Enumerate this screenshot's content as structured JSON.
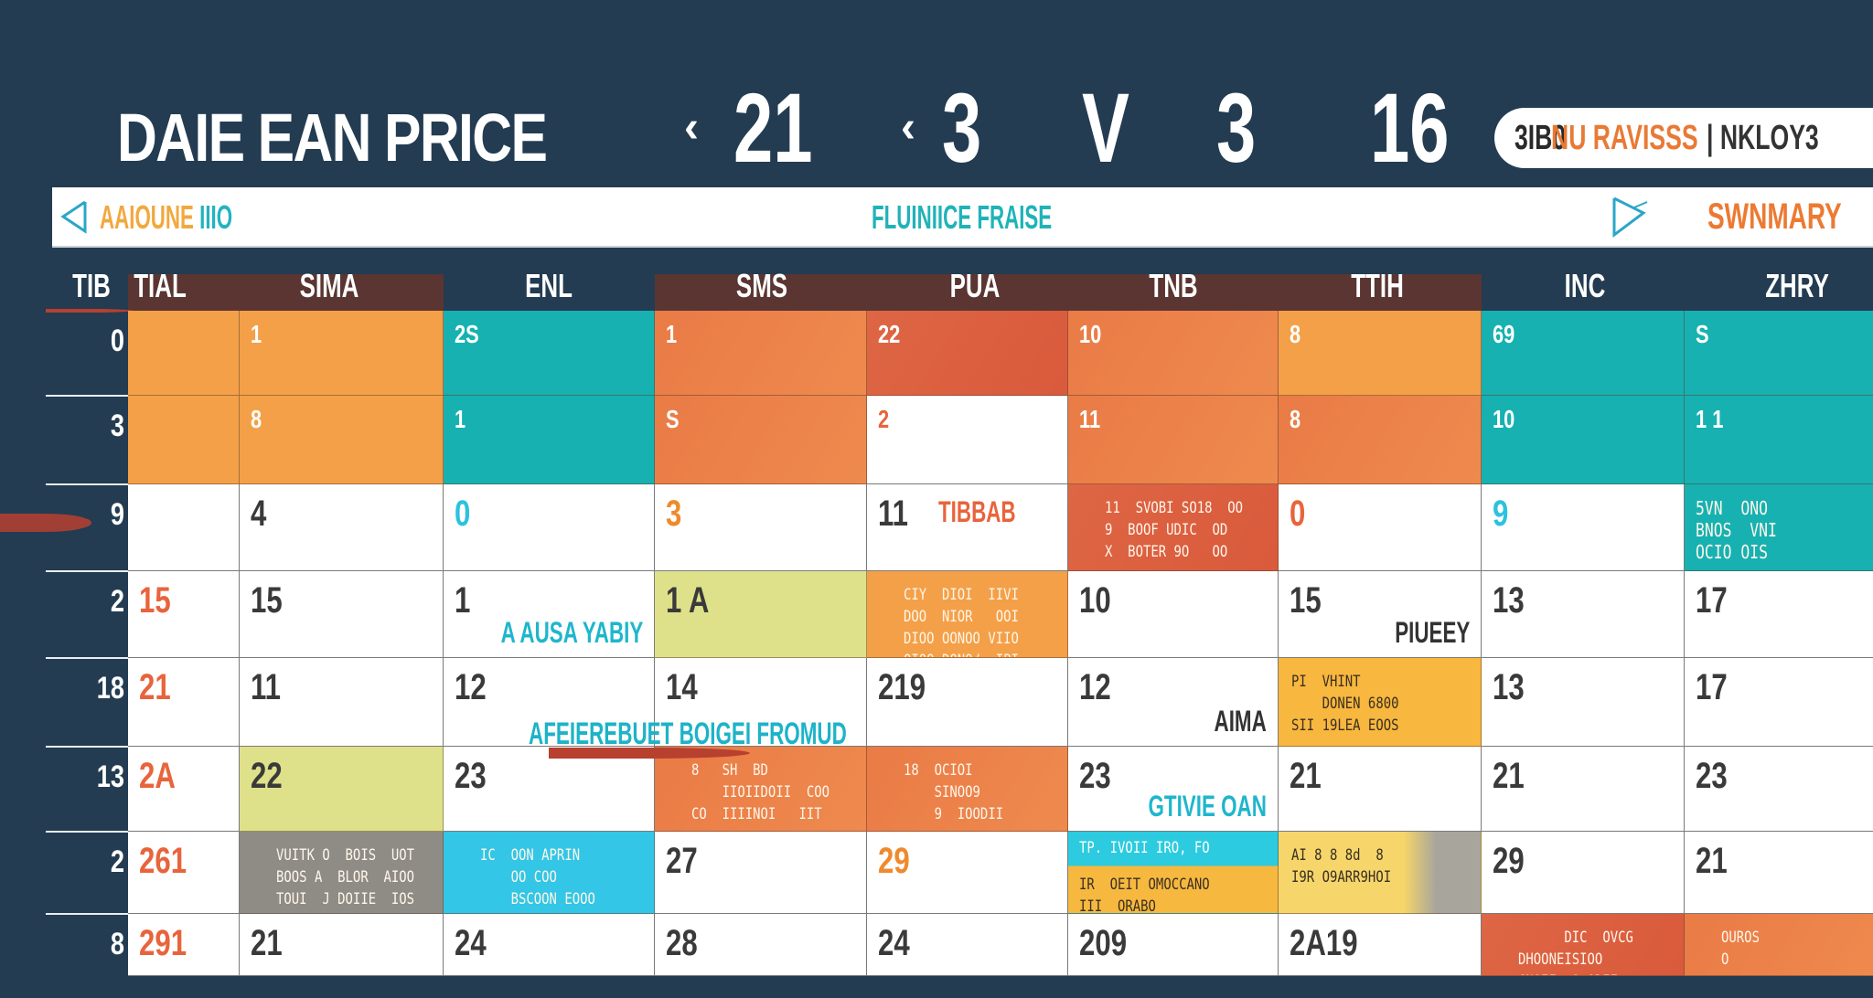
{
  "header": {
    "title": "DAIE EAN PRICE",
    "nav": [
      {
        "chevron": "‹",
        "value": "21"
      },
      {
        "chevron": "‹",
        "value": "3"
      },
      {
        "chevron": "",
        "value": "V"
      },
      {
        "chevron": "",
        "value": "3"
      },
      {
        "chevron": "",
        "value": "16"
      }
    ],
    "pill": {
      "part1": "3IB0",
      "part2": "NU RAVISSS",
      "part3": "| NKLOY3"
    }
  },
  "toolbar": {
    "left_label_a": "AAIOUNE",
    "left_label_b": "IIIO",
    "center_label": "FLUINIICE FRAISE",
    "right_label": "SWNMARY"
  },
  "colors": {
    "background": "#233c52",
    "orange": "#f39a3f",
    "dark_orange": "#e87546",
    "red_orange": "#df6540",
    "teal": "#18b2b0",
    "cyan": "#2dc8e3",
    "lime": "#d9dd80",
    "yellow": "#f7b63a",
    "gray": "#8d8b85",
    "header_band": "#5a3532"
  },
  "grid": {
    "col_headers": [
      "TIB",
      "TIAL",
      "SIMA",
      "ENL",
      "SMS",
      "PUA",
      "TNB",
      "TTIH",
      "INC",
      "ZHRY"
    ],
    "row_labels": [
      "0",
      "3",
      "9",
      "2",
      "18",
      "13",
      "2",
      "8"
    ],
    "rows": [
      [
        {
          "num": "",
          "fill": "orange"
        },
        {
          "num": "1",
          "fill": "orange",
          "num_color": "white"
        },
        {
          "num": "2S",
          "fill": "teal",
          "num_color": "white"
        },
        {
          "num": "1",
          "fill": "dark_orange",
          "num_color": "white"
        },
        {
          "num": "22",
          "fill": "red_orange",
          "num_color": "white"
        },
        {
          "num": "10",
          "fill": "dark_orange",
          "num_color": "white"
        },
        {
          "num": "8",
          "fill": "orange",
          "num_color": "white"
        },
        {
          "num": "69",
          "fill": "teal",
          "num_color": "white"
        },
        {
          "num": "S",
          "fill": "teal",
          "num_color": "white"
        }
      ],
      [
        {
          "num": "",
          "fill": "orange"
        },
        {
          "num": "8",
          "fill": "orange",
          "num_color": "white"
        },
        {
          "num": "1",
          "fill": "teal",
          "num_color": "white"
        },
        {
          "num": "S",
          "fill": "dark_orange",
          "num_color": "white"
        },
        {
          "num": "2",
          "fill": "white",
          "num_color": "red"
        },
        {
          "num": "11",
          "fill": "dark_orange",
          "num_color": "white"
        },
        {
          "num": "8",
          "fill": "dark_orange",
          "num_color": "white"
        },
        {
          "num": "10",
          "fill": "teal",
          "num_color": "white"
        },
        {
          "num": "1 1",
          "fill": "teal",
          "num_color": "white"
        }
      ],
      [
        {
          "num": "",
          "fill": "white"
        },
        {
          "num": "4",
          "fill": "white"
        },
        {
          "num": "0",
          "fill": "white",
          "num_color": "cyan"
        },
        {
          "num": "3",
          "fill": "white",
          "num_color": "orange"
        },
        {
          "num": "11",
          "fill": "white",
          "label": "TIBBAB",
          "label_color": "red"
        },
        {
          "num": "",
          "fill": "red_orange",
          "event": "11  SVOBI SO18  OO\n9  BOOF UDIC  OD\nX  BOTER 9O   OO"
        },
        {
          "num": "0",
          "fill": "white",
          "num_color": "red"
        },
        {
          "num": "9",
          "fill": "white",
          "num_color": "cyan"
        },
        {
          "num": "",
          "fill": "teal",
          "event": "5VN  ONO\nBNOS  VNI\nOCIO OIS"
        }
      ],
      [
        {
          "num": "15",
          "fill": "white",
          "num_color": "red"
        },
        {
          "num": "15",
          "fill": "white"
        },
        {
          "num": "1",
          "fill": "white",
          "label": "A AUSA YABIY",
          "label_color": "cyan"
        },
        {
          "num": "1 A",
          "fill": "lime"
        },
        {
          "num": "",
          "fill": "orange",
          "event": "CIY  DIOI  IIVI\nDOO  NIOR   OOI\nDIOO OONOO VIIO\nOIOO DONO/  IPI"
        },
        {
          "num": "10",
          "fill": "white"
        },
        {
          "num": "15",
          "fill": "white",
          "label": "PIUEEY",
          "label_color": "dark"
        },
        {
          "num": "13",
          "fill": "white"
        },
        {
          "num": "17",
          "fill": "white"
        }
      ],
      [
        {
          "num": "21",
          "fill": "white",
          "num_color": "red"
        },
        {
          "num": "11",
          "fill": "white"
        },
        {
          "num": "12",
          "fill": "white"
        },
        {
          "num": "14",
          "fill": "white"
        },
        {
          "num": "219",
          "fill": "white"
        },
        {
          "num": "12",
          "fill": "white",
          "label": "AIMA",
          "label_color": "dark"
        },
        {
          "num": "",
          "fill": "yellow",
          "event": "PI  VHINT\n    DONEN 6800\nSII 19LEA EOOS"
        },
        {
          "num": "13",
          "fill": "white"
        },
        {
          "num": "17",
          "fill": "white"
        }
      ],
      [
        {
          "num": "2A",
          "fill": "white",
          "num_color": "red"
        },
        {
          "num": "22",
          "fill": "lime"
        },
        {
          "num": "23",
          "fill": "white"
        },
        {
          "num": "",
          "fill": "dark_orange",
          "event": "8   SH  BD\n    IIOIIDOII  COO\nCO  IIIINOI   IIT"
        },
        {
          "num": "",
          "fill": "dark_orange",
          "event": "18  OCIOI\n    SINOO9\n    9  IOODII"
        },
        {
          "num": "23",
          "fill": "white",
          "label": "GTIVIE OAN",
          "label_color": "cyan"
        },
        {
          "num": "21",
          "fill": "white"
        },
        {
          "num": "21",
          "fill": "white"
        },
        {
          "num": "23",
          "fill": "white"
        }
      ],
      [
        {
          "num": "261",
          "fill": "white",
          "num_color": "red"
        },
        {
          "num": "",
          "fill": "gray",
          "event": "VUITK O  BOIS  UOT\nBOOS A  BLOR  AIOO\nTOUI  J DOIIE  IOS"
        },
        {
          "num": "",
          "fill": "cyan",
          "event": "IC  OON APRIN\n    OO COO\n    BSCOON EOOO"
        },
        {
          "num": "27",
          "fill": "white"
        },
        {
          "num": "29",
          "fill": "white",
          "num_color": "orange"
        },
        {
          "num": "",
          "fill": "split_cyan_yellow",
          "event_top": "TP. IVOII IRO, FO",
          "event_bottom": "IR  OEIT OMOCCANO\nIII  ORABO"
        },
        {
          "num": "",
          "fill": "yellow_gray",
          "event": "AI 8 8 8d  8\nI9R O9ARR9HOI"
        },
        {
          "num": "29",
          "fill": "white"
        },
        {
          "num": "21",
          "fill": "white"
        }
      ],
      [
        {
          "num": "291",
          "fill": "white",
          "num_color": "red"
        },
        {
          "num": "21",
          "fill": "white"
        },
        {
          "num": "24",
          "fill": "white"
        },
        {
          "num": "28",
          "fill": "white"
        },
        {
          "num": "24",
          "fill": "white"
        },
        {
          "num": "209",
          "fill": "white"
        },
        {
          "num": "2A19",
          "fill": "white"
        },
        {
          "num": "",
          "fill": "red_orange",
          "event": "      DIC  OVCG\nDHOONEISIOO\nCNOII  O.ODII"
        },
        {
          "num": "",
          "fill": "dark_orange",
          "event": "OUROS\nO"
        }
      ]
    ],
    "band_labels": [
      "AFEIEREBUET BOIGEI FROMUD"
    ]
  }
}
